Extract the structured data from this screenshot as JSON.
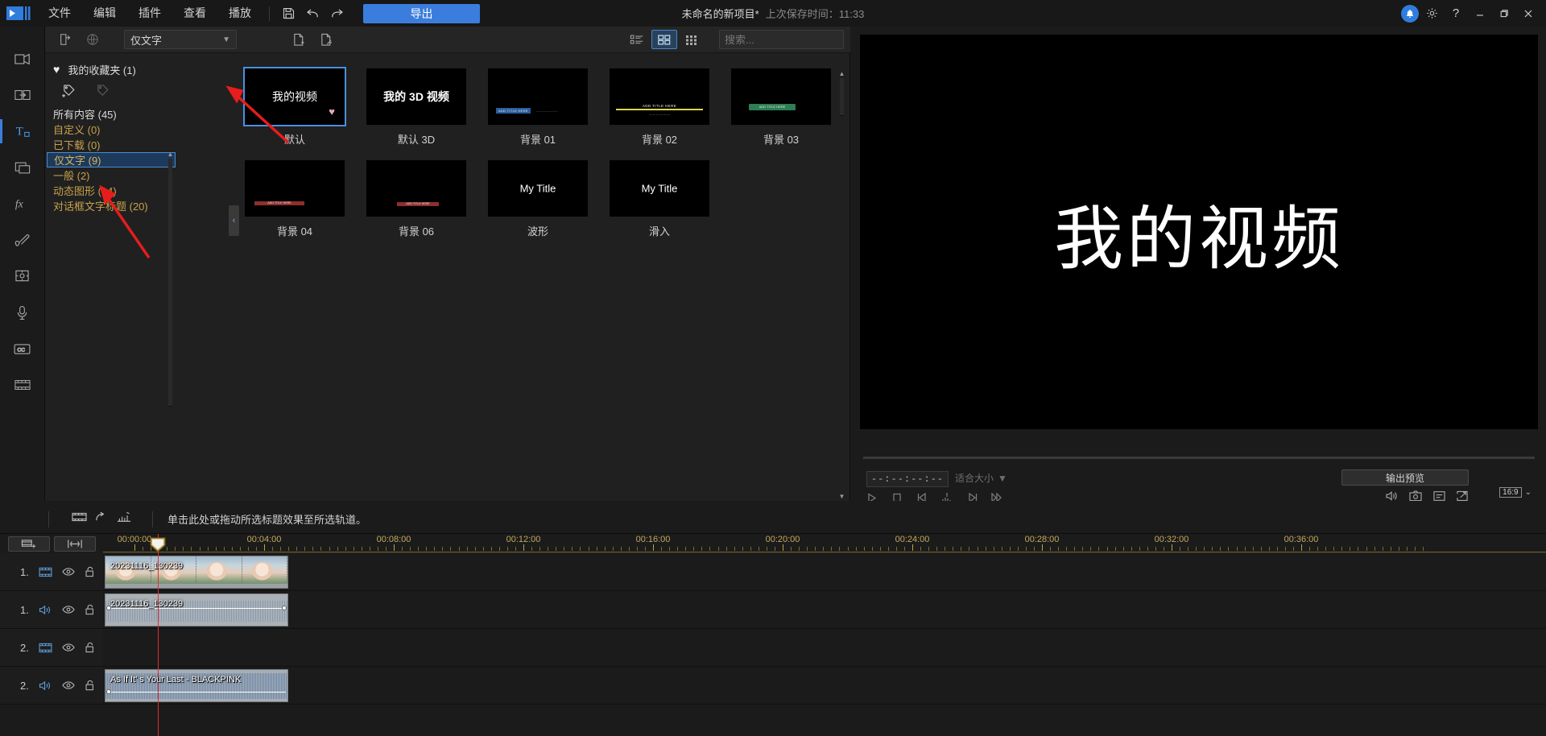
{
  "titlebar": {
    "logo_icon": "corel-videostudio-logo-icon",
    "menus": [
      "文件",
      "编辑",
      "插件",
      "查看",
      "播放"
    ],
    "save_icon": "save-icon",
    "undo_icon": "undo-icon",
    "redo_icon": "redo-icon",
    "export_label": "导出",
    "project_name": "未命名的新项目*",
    "last_saved": "上次保存时间：11:33",
    "bell_icon": "notification-bell-icon",
    "settings_icon": "gear-icon",
    "help_icon": "help-question-icon",
    "minimize_icon": "minimize-icon",
    "maximize_icon": "maximize-restore-icon",
    "close_icon": "close-icon"
  },
  "rail": [
    {
      "name": "media-library",
      "icon": "media-icon"
    },
    {
      "name": "transitions",
      "icon": "transition-icon"
    },
    {
      "name": "titles",
      "icon": "title-T-icon",
      "active": true,
      "label": "T"
    },
    {
      "name": "overlays",
      "icon": "overlay-icon"
    },
    {
      "name": "effects",
      "icon": "fx-icon",
      "label": "fx"
    },
    {
      "name": "paint",
      "icon": "paint-brush-icon"
    },
    {
      "name": "motion-tracking",
      "icon": "motion-tracking-icon"
    },
    {
      "name": "voice-record",
      "icon": "microphone-icon"
    },
    {
      "name": "captions",
      "icon": "cc-icon"
    },
    {
      "name": "storyboard",
      "icon": "storyboard-icon"
    }
  ],
  "library": {
    "toolbar": {
      "import_icon": "import-media-icon",
      "globe_icon": "globe-download-icon",
      "filter_value": "仅文字",
      "filter_chevron": "chevron-down-icon",
      "new_template_icon": "add-template-icon",
      "edit_template_icon": "edit-template-icon",
      "view_list_icon": "list-view-icon",
      "view_grid_icon": "grid-view-icon",
      "view_dense_icon": "dense-grid-view-icon",
      "search_placeholder": "搜索...",
      "search_value": "",
      "search_icon": "search-icon"
    },
    "favorites_label": "我的收藏夹 (1)",
    "heart_icon": "heart-icon",
    "add_tag_icon": "add-tag-icon",
    "tag_icon": "tag-icon",
    "categories": [
      {
        "label": "所有内容 (45)",
        "kind": "all"
      },
      {
        "label": "自定义  (0)",
        "kind": "item"
      },
      {
        "label": "已下载  (0)",
        "kind": "item"
      },
      {
        "label": "仅文字  (9)",
        "kind": "item",
        "selected": true
      },
      {
        "label": "一般  (2)",
        "kind": "item"
      },
      {
        "label": "动态图形  (14)",
        "kind": "item"
      },
      {
        "label": "对话框文字标题  (20)",
        "kind": "item"
      }
    ],
    "scroll_up_icon": "caret-up-icon",
    "scroll_down_icon": "caret-down-icon",
    "collapse_icon": "collapse-panel-chevron-icon",
    "items": [
      {
        "label": "默认",
        "preview_text": "我的视频",
        "style": "plain",
        "selected": true,
        "favorited": true
      },
      {
        "label": "默认 3D",
        "preview_text": "我的 3D 视频",
        "style": "bold3d"
      },
      {
        "label": "背景 01",
        "preview_text": "ADD TITLE HERE",
        "style": "bluebar"
      },
      {
        "label": "背景 02",
        "preview_text": "ADD TITLE HERE",
        "style": "yellowline"
      },
      {
        "label": "背景 03",
        "preview_text": "ADD TITLE HERE",
        "style": "greenbar"
      },
      {
        "label": "背景 04",
        "preview_text": "ADD TITLE HERE",
        "style": "redbar"
      },
      {
        "label": "背景 06",
        "preview_text": "ADD TITLE HERE",
        "style": "redbar2"
      },
      {
        "label": "波形",
        "preview_text": "My Title",
        "style": "plaintitle"
      },
      {
        "label": "滑入",
        "preview_text": "My Title",
        "style": "plaintitle"
      }
    ]
  },
  "preview": {
    "stage_text": "我的视频",
    "timecode": "--:--:--:--",
    "fit_label": "适合大小",
    "fit_chevron": "chevron-down-icon",
    "transport": [
      {
        "name": "play-button",
        "icon": "play-icon"
      },
      {
        "name": "stop-button",
        "icon": "stop-icon"
      },
      {
        "name": "previous-frame-button",
        "icon": "prev-frame-icon"
      },
      {
        "name": "split-clip-button",
        "icon": "split-clip-icon"
      },
      {
        "name": "next-frame-button",
        "icon": "next-frame-icon"
      },
      {
        "name": "fast-forward-button",
        "icon": "fast-forward-icon"
      }
    ],
    "output_preview_label": "输出预览",
    "volume_icon": "speaker-volume-icon",
    "snapshot_icon": "camera-snapshot-icon",
    "subtitle_icon": "subtitle-panel-icon",
    "expand_icon": "expand-external-icon",
    "aspect_value": "16:9",
    "aspect_chevron": "chevron-down-icon",
    "grip_dots": "······"
  },
  "hint": {
    "record_icon": "capture-icon",
    "rotate_icon": "rotate-icon",
    "keyframe_icon": "keyframe-icon",
    "text": "单击此处或拖动所选标题效果至所选轨道。"
  },
  "timeline": {
    "add_track_icon": "add-track-icon",
    "mix_icon": "audio-mixer-icon",
    "ruler_labels": [
      "00:00:00",
      "00:04:00",
      "00:08:00",
      "00:12:00",
      "00:16:00",
      "00:20:00",
      "00:24:00",
      "00:28:00",
      "00:32:00",
      "00:36:00"
    ],
    "playhead_icon": "playhead-marker-icon",
    "tracks": [
      {
        "num": "1.",
        "type": "video",
        "type_icon": "video-track-icon",
        "eye_icon": "eye-visible-icon",
        "lock_icon": "unlocked-icon",
        "clip": {
          "name": "20231116_130239",
          "kind": "video"
        }
      },
      {
        "num": "1.",
        "type": "audio",
        "type_icon": "audio-track-icon",
        "eye_icon": "eye-visible-icon",
        "lock_icon": "unlocked-icon",
        "clip": {
          "name": "20231116_130239",
          "kind": "audio"
        }
      },
      {
        "num": "2.",
        "type": "video",
        "type_icon": "video-track-icon",
        "eye_icon": "eye-visible-icon",
        "lock_icon": "unlocked-icon",
        "clip": null
      },
      {
        "num": "2.",
        "type": "audio",
        "type_icon": "audio-track-icon",
        "eye_icon": "eye-visible-icon",
        "lock_icon": "unlocked-icon",
        "clip": {
          "name": "As If It’  s Your Last - BLACKPINK",
          "kind": "music"
        }
      }
    ]
  },
  "colors": {
    "accent_blue": "#3b7ddd",
    "selection_border": "#4a90e2",
    "category_gold": "#c8a24a",
    "ruler_gold": "#c2a95a",
    "playhead_red": "#e03030",
    "annotation_red": "#e81c1c"
  }
}
